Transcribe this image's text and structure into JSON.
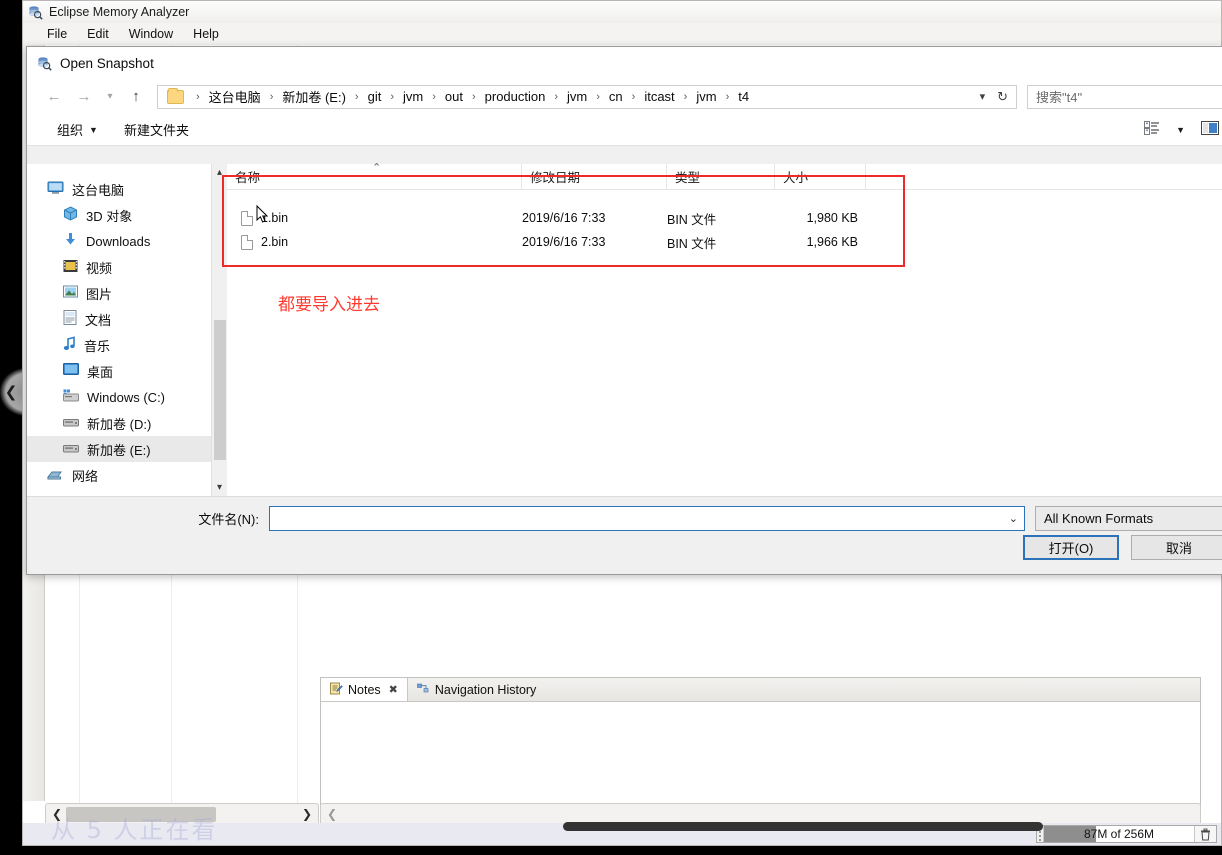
{
  "eclipse": {
    "title": "Eclipse Memory Analyzer",
    "app_icon": "memory-analyzer-icon",
    "menu": [
      "File",
      "Edit",
      "Window",
      "Help"
    ],
    "tabs": [
      {
        "label": "Notes",
        "icon": "notes-icon",
        "close": "✖",
        "active": true
      },
      {
        "label": "Navigation History",
        "icon": "navigation-history-icon",
        "active": false
      }
    ],
    "status": {
      "heap": "87M of 256M",
      "trash_icon": "trash-icon"
    },
    "watermark": "从 5 人正在看"
  },
  "dialog": {
    "title": "Open Snapshot",
    "icon": "memory-analyzer-icon",
    "nav": {
      "back_icon": "arrow-left-icon",
      "forward_icon": "arrow-right-icon",
      "history_icon": "chevron-down-icon",
      "up_icon": "arrow-up-icon",
      "folder_icon": "folder-icon",
      "dropdown_icon": "chevron-down-icon",
      "refresh_icon": "refresh-icon",
      "separator": "›"
    },
    "breadcrumb": [
      "这台电脑",
      "新加卷 (E:)",
      "git",
      "jvm",
      "out",
      "production",
      "jvm",
      "cn",
      "itcast",
      "jvm",
      "t4"
    ],
    "search": {
      "value": "搜索\"t4\"",
      "icon": "search-icon"
    },
    "toolbar": {
      "organize": "组织",
      "organize_caret": "▼",
      "new_folder": "新建文件夹",
      "view_icon": "view-list-icon",
      "view_caret": "▼",
      "preview_icon": "preview-pane-icon"
    },
    "nav_pane": {
      "items": [
        {
          "label": "这台电脑",
          "icon": "computer-icon",
          "level": "root",
          "selected": false
        },
        {
          "label": "3D 对象",
          "icon": "3d-objects-icon",
          "level": "child",
          "selected": false
        },
        {
          "label": "Downloads",
          "icon": "downloads-icon",
          "level": "child",
          "selected": false
        },
        {
          "label": "视频",
          "icon": "videos-icon",
          "level": "child",
          "selected": false
        },
        {
          "label": "图片",
          "icon": "pictures-icon",
          "level": "child",
          "selected": false
        },
        {
          "label": "文档",
          "icon": "documents-icon",
          "level": "child",
          "selected": false
        },
        {
          "label": "音乐",
          "icon": "music-icon",
          "level": "child",
          "selected": false
        },
        {
          "label": "桌面",
          "icon": "desktop-icon",
          "level": "child",
          "selected": false
        },
        {
          "label": "Windows (C:)",
          "icon": "system-drive-icon",
          "level": "child",
          "selected": false
        },
        {
          "label": "新加卷 (D:)",
          "icon": "drive-icon",
          "level": "child",
          "selected": false
        },
        {
          "label": "新加卷 (E:)",
          "icon": "drive-icon",
          "level": "child",
          "selected": true
        },
        {
          "label": "网络",
          "icon": "network-icon",
          "level": "root",
          "selected": false
        }
      ],
      "scroll_up_icon": "chevron-up-icon",
      "scroll_down_icon": "chevron-down-icon"
    },
    "file_list": {
      "columns": [
        "名称",
        "修改日期",
        "类型",
        "大小"
      ],
      "sort_indicator": "⌃",
      "rows": [
        {
          "name": "1.bin",
          "modified": "2019/6/16 7:33",
          "type": "BIN 文件",
          "size": "1,980 KB",
          "icon": "file-icon"
        },
        {
          "name": "2.bin",
          "modified": "2019/6/16 7:33",
          "type": "BIN 文件",
          "size": "1,966 KB",
          "icon": "file-icon"
        }
      ]
    },
    "annotation": {
      "text": "都要导入进去",
      "color": "#ff3b30",
      "highlight_color": "#ee2b2b"
    },
    "footer": {
      "filename_label": "文件名(N):",
      "filename_value": "",
      "filename_caret": "⌄",
      "format": "All Known Formats",
      "open_button": "打开(O)",
      "cancel_button": "取消"
    }
  }
}
